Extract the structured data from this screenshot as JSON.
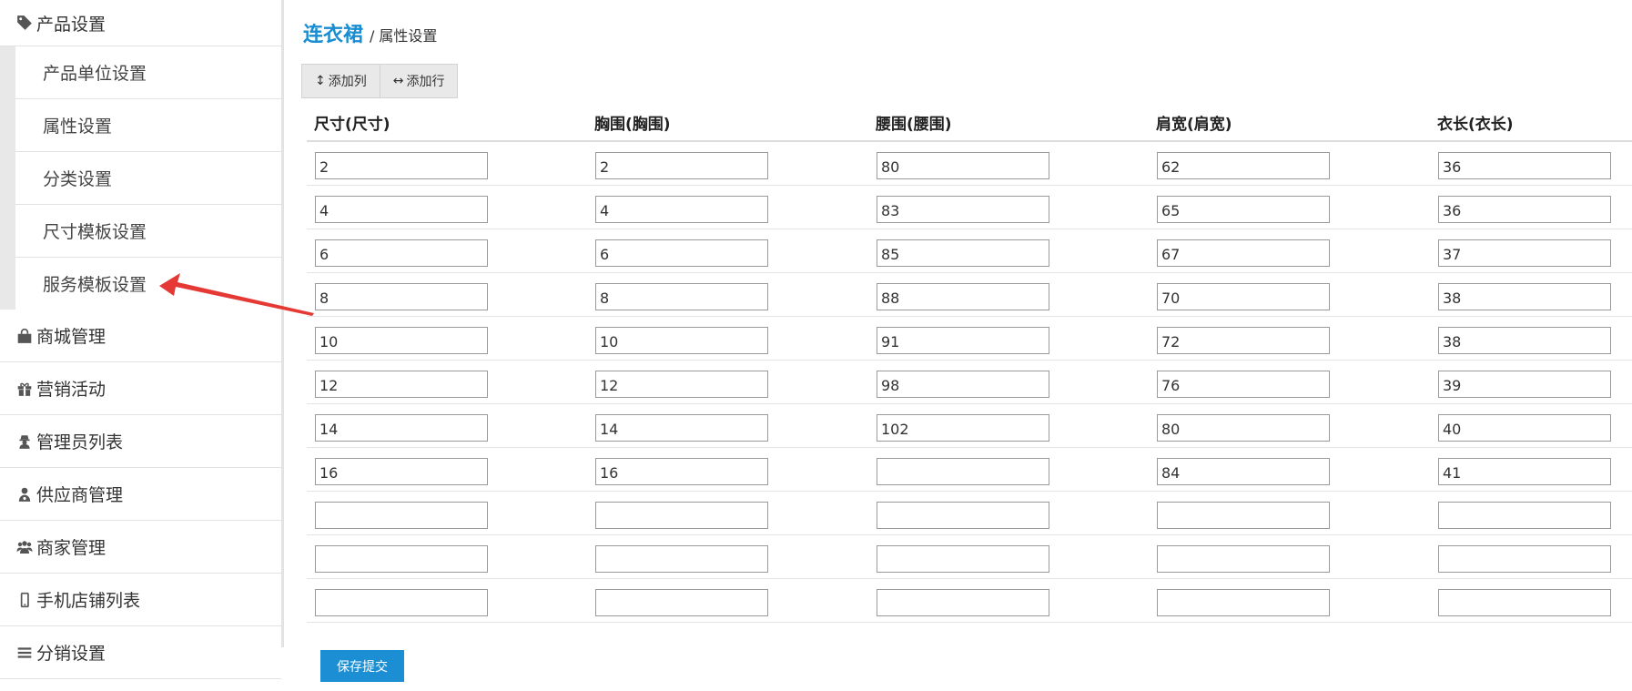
{
  "sidebar": {
    "section_title": "产品设置",
    "sub_items": [
      {
        "label": "产品单位设置"
      },
      {
        "label": "属性设置"
      },
      {
        "label": "分类设置"
      },
      {
        "label": "尺寸模板设置"
      },
      {
        "label": "服务模板设置"
      }
    ],
    "menu_items": [
      {
        "label": "商城管理",
        "icon": "shopping-bag-icon"
      },
      {
        "label": "营销活动",
        "icon": "gift-icon"
      },
      {
        "label": "管理员列表",
        "icon": "user-secret-icon"
      },
      {
        "label": "供应商管理",
        "icon": "user-tie-icon"
      },
      {
        "label": "商家管理",
        "icon": "users-icon"
      },
      {
        "label": "手机店铺列表",
        "icon": "mobile-icon"
      },
      {
        "label": "分销设置",
        "icon": "bars-icon"
      }
    ]
  },
  "breadcrumb": {
    "main": "连衣裙",
    "separator": "/",
    "current": "属性设置"
  },
  "toolbar": {
    "add_column_label": "添加列",
    "add_row_label": "添加行"
  },
  "table": {
    "columns": [
      "尺寸(尺寸)",
      "胸围(胸围)",
      "腰围(腰围)",
      "肩宽(肩宽)",
      "衣长(衣长)"
    ],
    "rows": [
      [
        "2",
        "2",
        "80",
        "62",
        "36"
      ],
      [
        "4",
        "4",
        "83",
        "65",
        "36"
      ],
      [
        "6",
        "6",
        "85",
        "67",
        "37"
      ],
      [
        "8",
        "8",
        "88",
        "70",
        "38"
      ],
      [
        "10",
        "10",
        "91",
        "72",
        "38"
      ],
      [
        "12",
        "12",
        "98",
        "76",
        "39"
      ],
      [
        "14",
        "14",
        "102",
        "80",
        "40"
      ],
      [
        "16",
        "16",
        "",
        "84",
        "41"
      ],
      [
        "",
        "",
        "",
        "",
        ""
      ],
      [
        "",
        "",
        "",
        "",
        ""
      ],
      [
        "",
        "",
        "",
        "",
        ""
      ]
    ]
  },
  "save_button_label": "保存提交",
  "colors": {
    "accent": "#1a8dd1",
    "button": "#1c8fd4",
    "arrow": "#e53935"
  }
}
